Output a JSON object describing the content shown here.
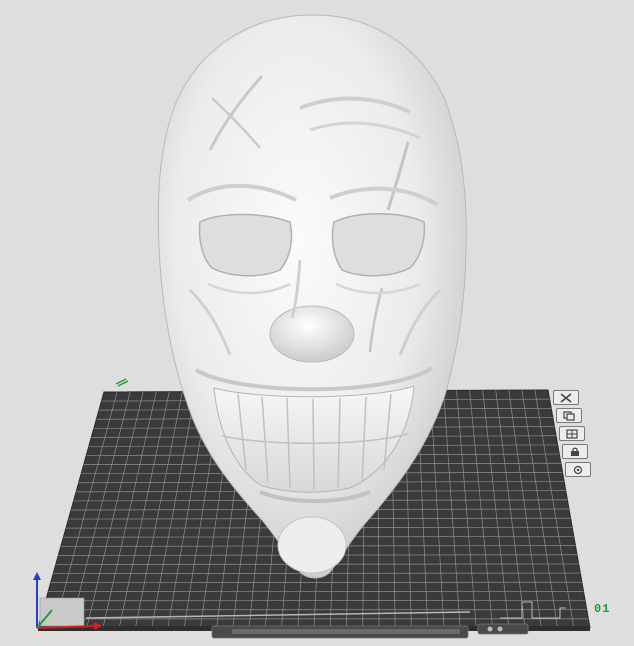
{
  "viewport": {
    "background": "#dedede",
    "bed": {
      "color": "#3a3a3a",
      "grid_color": "#8a8a8a",
      "label": "01"
    },
    "model": {
      "name": "mask-model",
      "color": "#f4f4f4"
    },
    "axes": {
      "x_color": "#d42020",
      "y_color": "#1e9e3a",
      "z_color": "#2040c8"
    }
  },
  "object_toolbar": {
    "items": [
      {
        "name": "delete-object-button",
        "icon": "close-icon"
      },
      {
        "name": "duplicate-object-button",
        "icon": "copy-icon"
      },
      {
        "name": "arrange-button",
        "icon": "grid-icon"
      },
      {
        "name": "lock-button",
        "icon": "lock-icon"
      },
      {
        "name": "settings-button",
        "icon": "gear-icon"
      }
    ]
  }
}
